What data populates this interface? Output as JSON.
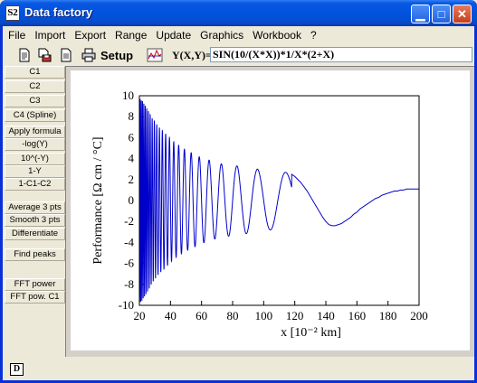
{
  "window": {
    "title": "Data factory",
    "icon_text": "S2",
    "controls": [
      "minimize",
      "maximize",
      "close"
    ]
  },
  "menu": [
    "File",
    "Import",
    "Export",
    "Range",
    "Update",
    "Graphics",
    "Workbook",
    "?"
  ],
  "toolbar": {
    "icons": [
      "new-document-icon",
      "save-icon",
      "print-icon",
      "graph-icon"
    ],
    "setup_label": "Setup",
    "formula_label": "Y(X,Y)=",
    "formula_value": "SIN(10/(X*X))*1/X*(2+X)"
  },
  "sidebar": [
    "C1",
    "C2",
    "C3",
    "C4 (Spline)",
    "Apply formula",
    "-log(Y)",
    "10^(-Y)",
    "1-Y",
    "1-C1-C2",
    "Average 3 pts",
    "Smooth 3 pts",
    "Differentiate",
    "Find peaks",
    "FFT power",
    "FFT pow. C1"
  ],
  "status": {
    "icon_text": "D"
  },
  "chart_data": {
    "type": "line",
    "title": "",
    "xlabel": "x [10⁻²  km]",
    "ylabel": "Performance [Ω cm / °C]",
    "xlim": [
      20,
      200
    ],
    "ylim": [
      -10,
      10
    ],
    "x_ticks": [
      20,
      40,
      60,
      80,
      100,
      120,
      140,
      160,
      180,
      200
    ],
    "y_ticks": [
      -10,
      -8,
      -6,
      -4,
      -2,
      0,
      2,
      4,
      6,
      8,
      10
    ],
    "grid": false,
    "color": "#0000cc",
    "series": [
      {
        "name": "",
        "x": [
          20,
          22,
          24,
          26,
          28,
          30,
          32,
          34,
          36,
          38,
          40,
          42,
          44,
          46,
          48,
          50,
          52,
          54,
          56,
          58,
          60,
          62,
          64,
          66,
          68,
          70,
          72,
          74,
          76,
          78,
          80,
          82,
          84,
          86,
          88,
          90,
          92,
          94,
          96,
          98,
          100,
          102,
          104,
          106,
          108,
          110,
          112,
          114,
          116,
          118,
          120,
          122,
          124,
          126,
          128,
          130,
          132,
          134,
          136,
          138,
          140,
          142,
          144,
          146,
          148,
          150,
          152,
          154,
          156,
          158,
          160,
          162,
          164,
          166,
          168,
          170,
          172,
          174,
          176,
          178,
          180,
          182,
          184,
          186,
          188,
          190,
          192,
          194,
          196,
          198,
          200
        ],
        "y_max": [
          9.8,
          9.5,
          9.0,
          8.5,
          7.9,
          7.5,
          7.1,
          6.8,
          6.5,
          6.2,
          5.9,
          5.6,
          5.4,
          5.2,
          5.0,
          4.8,
          4.7,
          4.5,
          4.4,
          4.2,
          4.1,
          4.0,
          3.9,
          3.8,
          3.7,
          3.6,
          3.5,
          3.5,
          3.4,
          3.4,
          3.4,
          3.3,
          3.3,
          3.2,
          3.2,
          3.1,
          3.1,
          3.0,
          3.0,
          2.9,
          2.9,
          2.9,
          2.8,
          2.8,
          2.8,
          2.8,
          2.8,
          2.7,
          2.6,
          2.5,
          2.3,
          2.0,
          1.7,
          1.3,
          0.9,
          0.4,
          -0.1,
          -0.6,
          -1.1,
          -1.6,
          -2.0,
          -2.3,
          -2.4,
          -2.4,
          -2.3,
          -2.2,
          -2.0,
          -1.8,
          -1.6,
          -1.3,
          -1.1,
          -0.8,
          -0.6,
          -0.4,
          -0.2,
          0.0,
          0.2,
          0.3,
          0.5,
          0.6,
          0.7,
          0.8,
          0.9,
          0.9,
          1.0,
          1.0,
          1.1,
          1.1,
          1.1,
          1.1,
          1.1
        ]
      }
    ]
  }
}
